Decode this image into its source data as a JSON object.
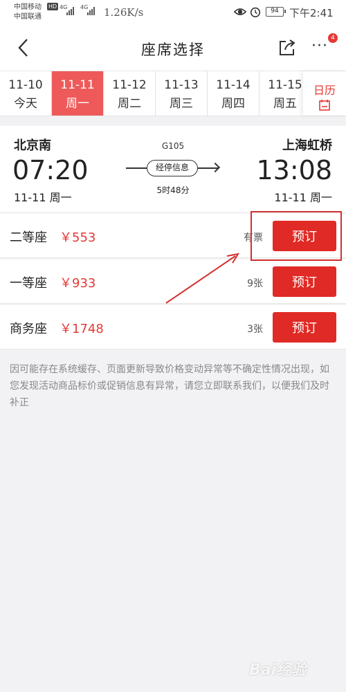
{
  "status_bar": {
    "carrier1": "中国移动",
    "carrier2": "中国联通",
    "hd": "HD",
    "network1": "4G",
    "network2": "4G",
    "speed": "1.26K/s",
    "battery": "94",
    "time": "下午2:41"
  },
  "nav": {
    "title": "座席选择",
    "badge_count": "4",
    "more": "···"
  },
  "dates": [
    {
      "date": "11-10",
      "weekday": "今天",
      "active": false
    },
    {
      "date": "11-11",
      "weekday": "周一",
      "active": true
    },
    {
      "date": "11-12",
      "weekday": "周二",
      "active": false
    },
    {
      "date": "11-13",
      "weekday": "周三",
      "active": false
    },
    {
      "date": "11-14",
      "weekday": "周四",
      "active": false
    },
    {
      "date": "11-15",
      "weekday": "周五",
      "active": false
    }
  ],
  "calendar_label": "日历",
  "train": {
    "from_station": "北京南",
    "to_station": "上海虹桥",
    "depart_time": "07:20",
    "arrive_time": "13:08",
    "depart_date": "11-11 周一",
    "arrive_date": "11-11 周一",
    "train_no": "G105",
    "stops_label": "经停信息",
    "duration": "5时48分"
  },
  "seats": [
    {
      "name": "二等座",
      "price": "￥553",
      "availability": "有票",
      "book_label": "预订"
    },
    {
      "name": "一等座",
      "price": "￥933",
      "availability": "9张",
      "book_label": "预订"
    },
    {
      "name": "商务座",
      "price": "￥1748",
      "availability": "3张",
      "book_label": "预订"
    }
  ],
  "notice": "因可能存在系统缓存、页面更新导致价格变动异常等不确定性情况出现，如您发现活动商品标价或促销信息有异常，请您立即联系我们，以便我们及时补正",
  "watermark": "Bai经验",
  "colors": {
    "accent": "#e53935",
    "active_tab": "#ee5a5a",
    "button": "#e02a25"
  }
}
